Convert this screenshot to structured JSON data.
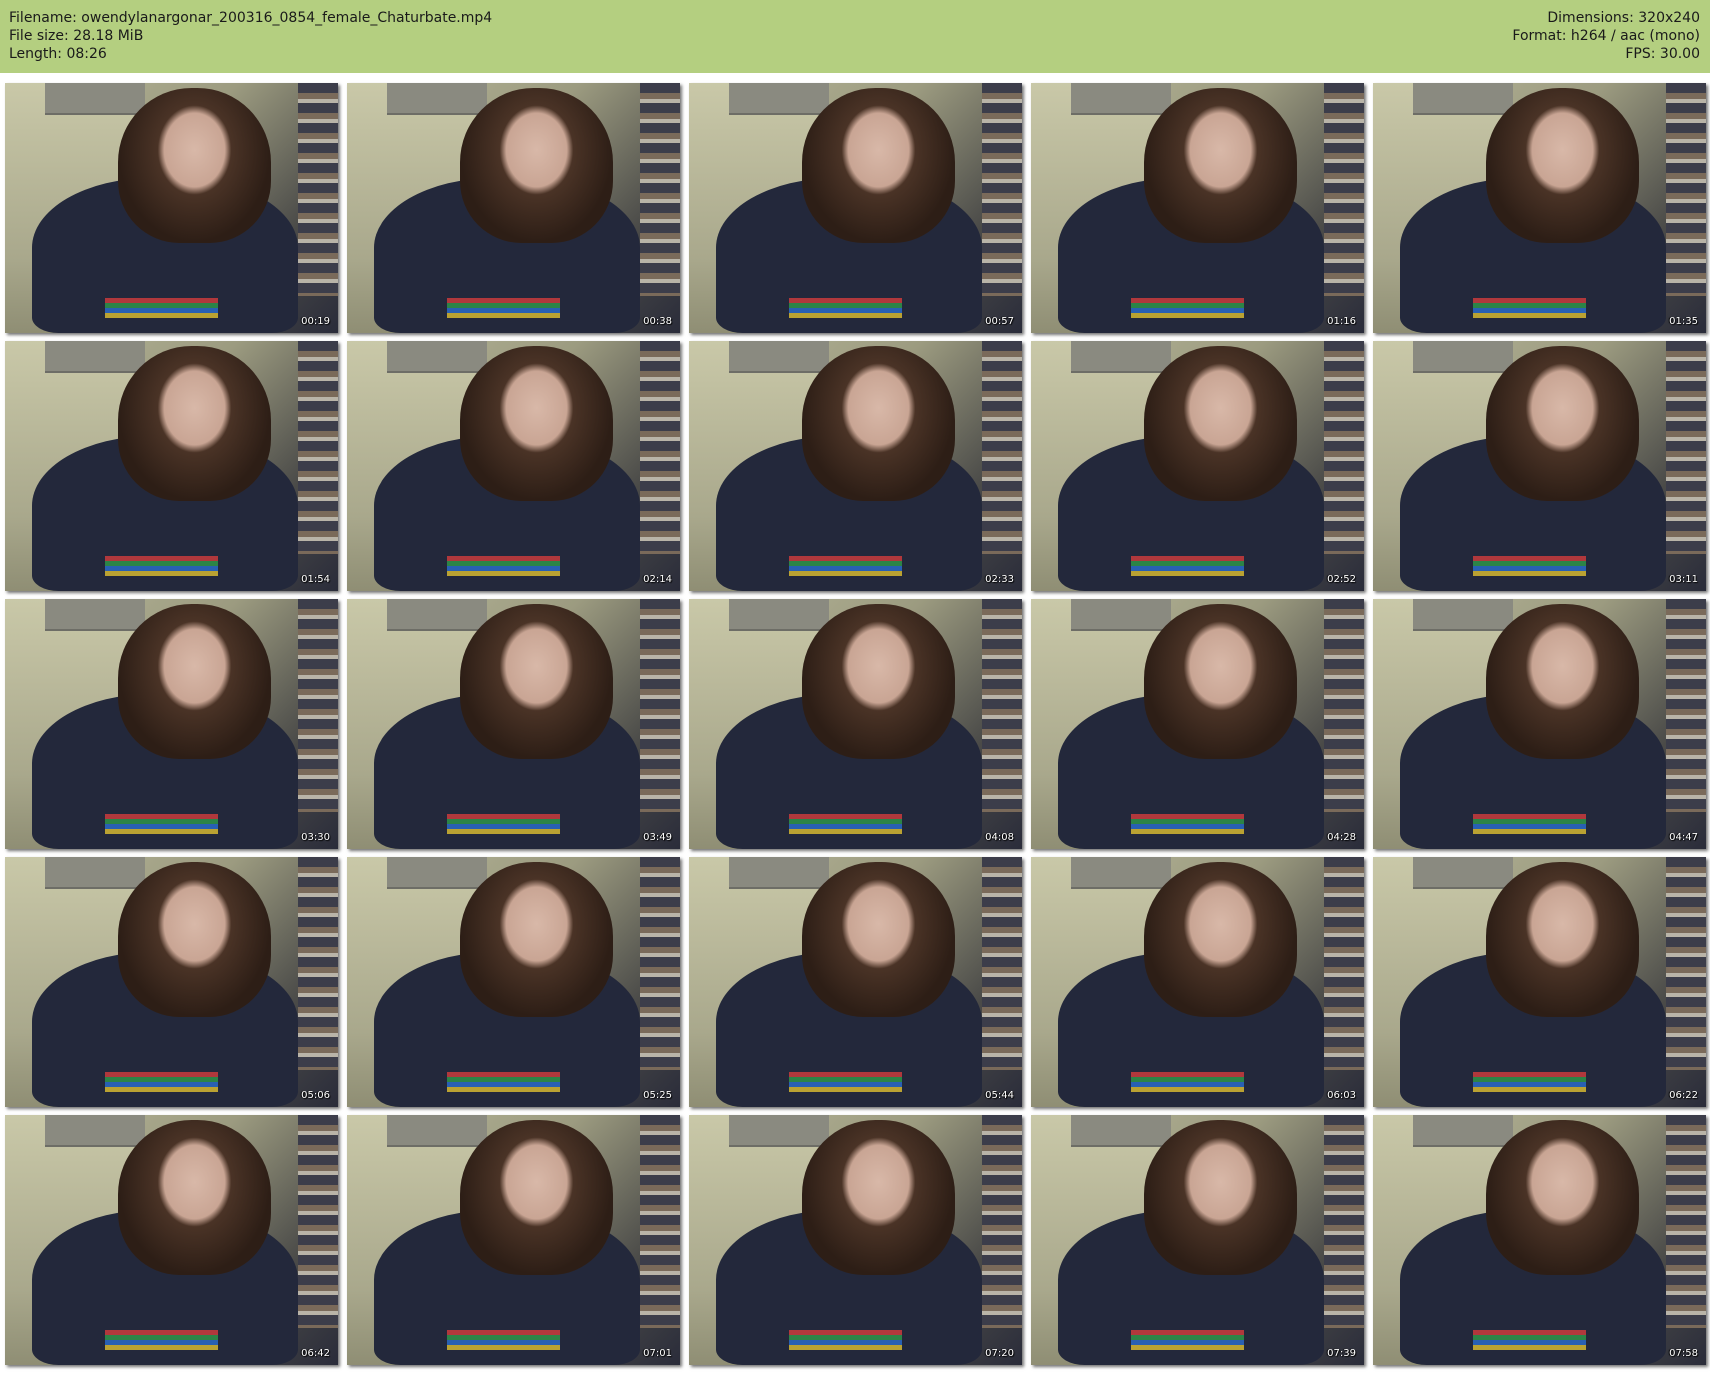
{
  "header": {
    "filename": "Filename: owendylanargonar_200316_0854_female_Chaturbate.mp4",
    "filesize": "File size: 28.18 MiB",
    "length": "Length: 08:26",
    "dimensions": "Dimensions: 320x240",
    "format": "Format: h264 / aac (mono)",
    "fps": "FPS: 30.00"
  },
  "colors": {
    "header_bg": "#b4cf80",
    "page_bg": "#ffffff",
    "timestamp_text": "#ffffff"
  },
  "thumbnails": [
    {
      "timestamp": "00:19"
    },
    {
      "timestamp": "00:38"
    },
    {
      "timestamp": "00:57"
    },
    {
      "timestamp": "01:16"
    },
    {
      "timestamp": "01:35"
    },
    {
      "timestamp": "01:54"
    },
    {
      "timestamp": "02:14"
    },
    {
      "timestamp": "02:33"
    },
    {
      "timestamp": "02:52"
    },
    {
      "timestamp": "03:11"
    },
    {
      "timestamp": "03:30"
    },
    {
      "timestamp": "03:49"
    },
    {
      "timestamp": "04:08"
    },
    {
      "timestamp": "04:28"
    },
    {
      "timestamp": "04:47"
    },
    {
      "timestamp": "05:06"
    },
    {
      "timestamp": "05:25"
    },
    {
      "timestamp": "05:44"
    },
    {
      "timestamp": "06:03"
    },
    {
      "timestamp": "06:22"
    },
    {
      "timestamp": "06:42"
    },
    {
      "timestamp": "07:01"
    },
    {
      "timestamp": "07:20"
    },
    {
      "timestamp": "07:39"
    },
    {
      "timestamp": "07:58"
    }
  ]
}
